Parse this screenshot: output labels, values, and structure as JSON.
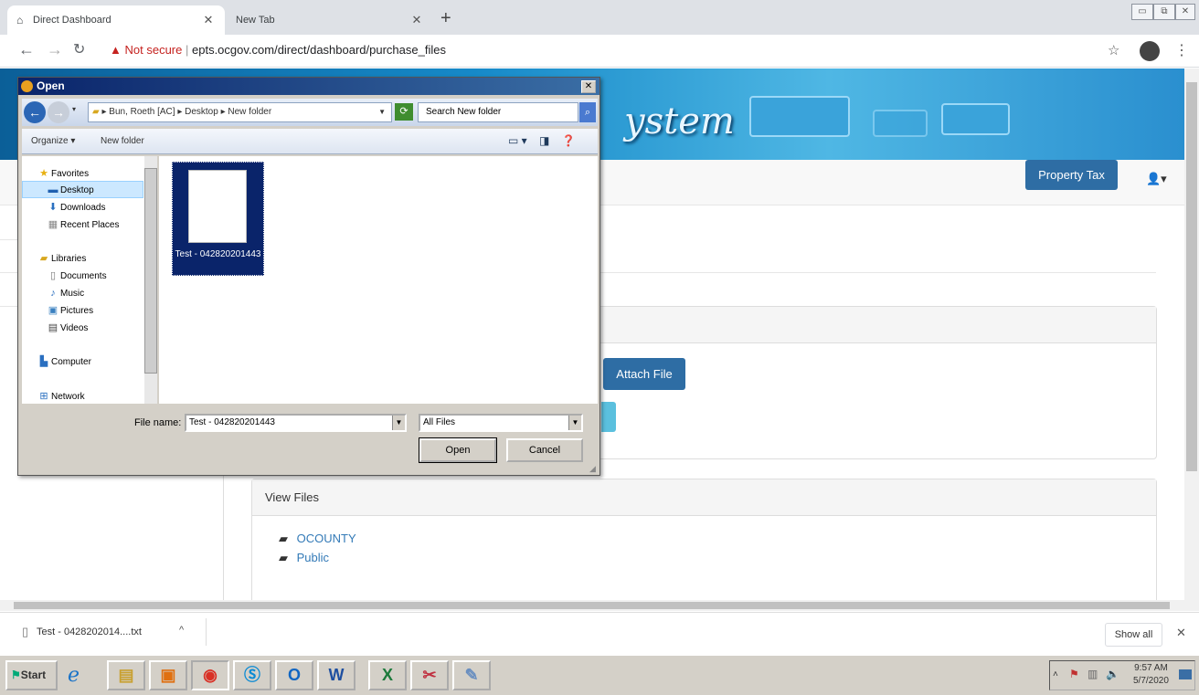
{
  "browser": {
    "tabs": [
      {
        "title": "Direct Dashboard",
        "icon": "home-icon"
      },
      {
        "title": "New Tab"
      }
    ],
    "security_label": "Not secure",
    "url": "epts.ocgov.com/direct/dashboard/purchase_files"
  },
  "page": {
    "banner_text": "ystem",
    "property_tax_button": "Property Tax",
    "attach_button": "Attach File",
    "view_files_heading": "View Files",
    "folders": [
      "OCOUNTY",
      "Public"
    ]
  },
  "dialog": {
    "title": "Open",
    "breadcrumb": "▸ Bun, Roeth [AC] ▸ Desktop ▸ New folder",
    "search_placeholder": "Search New folder",
    "organize_label": "Organize ▾",
    "new_folder_label": "New folder",
    "nav_items": {
      "favorites": "Favorites",
      "desktop": "Desktop",
      "downloads": "Downloads",
      "recent": "Recent Places",
      "libraries": "Libraries",
      "documents": "Documents",
      "music": "Music",
      "pictures": "Pictures",
      "videos": "Videos",
      "computer": "Computer",
      "network": "Network"
    },
    "file_item": "Test - 042820201443",
    "file_name_label": "File name:",
    "file_name_value": "Test - 042820201443",
    "file_type": "All Files",
    "open_button": "Open",
    "cancel_button": "Cancel"
  },
  "downloads": {
    "file": "Test - 0428202014....txt",
    "show_all": "Show all"
  },
  "taskbar": {
    "start_label": "Start",
    "time": "9:57 AM",
    "date": "5/7/2020"
  }
}
